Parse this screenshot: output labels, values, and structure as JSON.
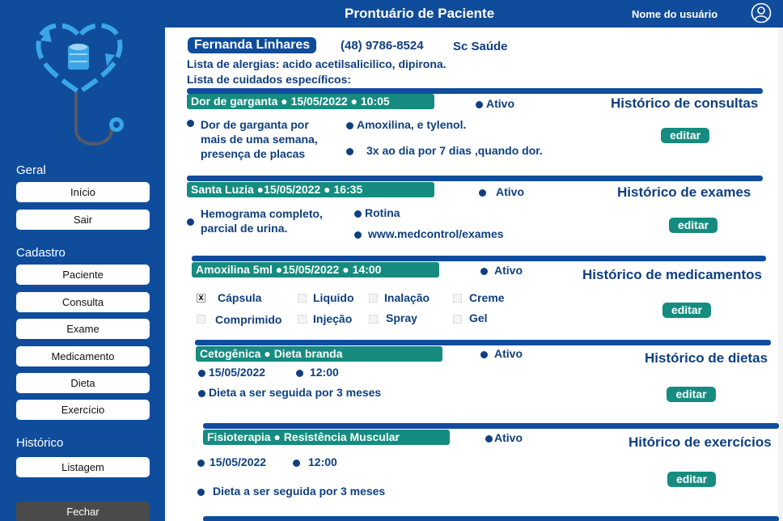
{
  "header": {
    "title": "Prontuário de Paciente",
    "user_name": "Nome do usuário"
  },
  "sidebar": {
    "sections": [
      {
        "label": "Geral",
        "items": [
          "Início",
          "Sair"
        ]
      },
      {
        "label": "Cadastro",
        "items": [
          "Paciente",
          "Consulta",
          "Exame",
          "Medicamento",
          "Dieta",
          "Exercício"
        ]
      },
      {
        "label": "Histórico",
        "items": [
          "Listagem"
        ]
      }
    ],
    "close_label": "Fechar"
  },
  "patient": {
    "name": "Fernanda Linhares",
    "phone": "(48) 9786-8524",
    "insurance": "Sc Saúde",
    "allergies": "Lista de alergias: acido acetilsalicilico, dipirona.",
    "care": "Lista de cuidados específicos:"
  },
  "consultas": {
    "tag": "Dor de garganta  ●  15/05/2022  ●  10:05",
    "status": "Ativo",
    "title": "Histórico de consultas",
    "symptom_line1": "Dor de garganta por",
    "symptom_line2": "mais de uma semana,",
    "symptom_line3": "presença de placas",
    "medication": "Amoxilina, e tylenol.",
    "dosage": "3x ao dia por 7 dias ,quando dor.",
    "edit": "editar"
  },
  "exames": {
    "tag": "Santa Luzia  ●15/05/2022   ●    16:35",
    "status": "Ativo",
    "title": "Histórico de exames",
    "desc_line1": "Hemograma completo,",
    "desc_line2": "parcial de urina.",
    "type": "Rotina",
    "link": "www.medcontrol/exames",
    "edit": "editar"
  },
  "medicamentos": {
    "tag": "Amoxilina  5ml  ●15/05/2022   ●  14:00",
    "status": "Ativo",
    "title": "Histórico de medicamentos",
    "forms": [
      {
        "label": "Cápsula",
        "checked": true
      },
      {
        "label": "Liquido",
        "checked": false
      },
      {
        "label": "Inalação",
        "checked": false
      },
      {
        "label": "Creme",
        "checked": false
      },
      {
        "label": "Comprimido",
        "checked": false
      },
      {
        "label": "Injeção",
        "checked": false
      },
      {
        "label": "Spray",
        "checked": false
      },
      {
        "label": "Gel",
        "checked": false
      }
    ],
    "check_mark": "x",
    "edit": "editar"
  },
  "dietas": {
    "tag": "Cetogênica  ● Dieta branda",
    "status": "Ativo",
    "title": "Histórico de dietas",
    "date": "15/05/2022",
    "time": "12:00",
    "desc": "Dieta a ser seguida por 3 meses",
    "edit": "editar"
  },
  "exercicios": {
    "tag": "Fisioterapia   ●  Resistência Muscular",
    "status": "Ativo",
    "title": "Hitórico de exercícios",
    "date": "15/05/2022",
    "time": "12:00",
    "desc": "Dieta a ser seguida por 3 meses",
    "edit": "editar"
  },
  "colors": {
    "primary": "#0f4c9c",
    "accent": "#168c80",
    "text": "#0f3f7f"
  }
}
